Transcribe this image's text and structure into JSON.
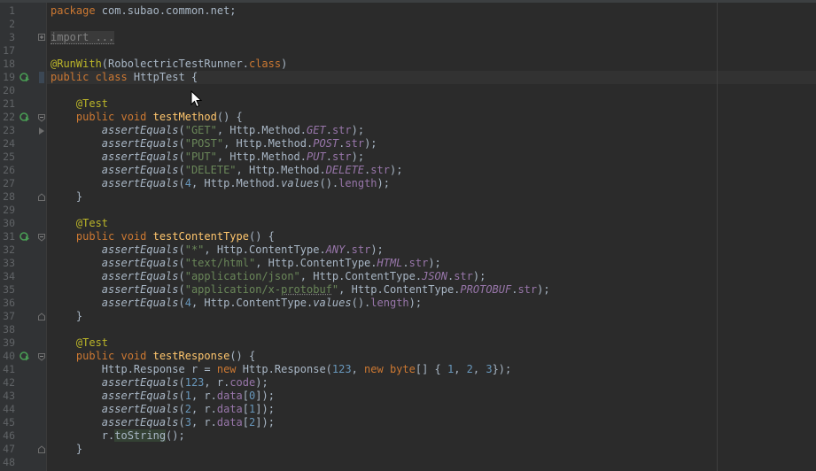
{
  "editor": {
    "file": "HttpTest",
    "current_line_index": 5,
    "lines": [
      {
        "n": "1",
        "tokens": [
          {
            "t": "package ",
            "c": "kw"
          },
          {
            "t": "com.subao.common.net;",
            "c": ""
          }
        ]
      },
      {
        "n": "2",
        "tokens": []
      },
      {
        "n": "3",
        "fold": "plus",
        "tokens": [
          {
            "t": "import ...",
            "c": "fold-box"
          }
        ]
      },
      {
        "n": "17",
        "tokens": []
      },
      {
        "n": "18",
        "tokens": [
          {
            "t": "@RunWith",
            "c": "ann"
          },
          {
            "t": "(RobolectricTestRunner.",
            "c": ""
          },
          {
            "t": "class",
            "c": "kw"
          },
          {
            "t": ")",
            "c": ""
          }
        ]
      },
      {
        "n": "19",
        "run": true,
        "tokens": [
          {
            "t": "public class ",
            "c": "kw"
          },
          {
            "t": "HttpTest {",
            "c": ""
          }
        ]
      },
      {
        "n": "20",
        "tokens": []
      },
      {
        "n": "21",
        "tokens": [
          {
            "t": "    ",
            "c": ""
          },
          {
            "t": "@Test",
            "c": "ann"
          }
        ]
      },
      {
        "n": "22",
        "run": true,
        "fold": "open",
        "tokens": [
          {
            "t": "    ",
            "c": ""
          },
          {
            "t": "public void ",
            "c": "kw"
          },
          {
            "t": "testMethod",
            "c": "fn"
          },
          {
            "t": "() {",
            "c": ""
          }
        ]
      },
      {
        "n": "23",
        "tokens": [
          {
            "t": "        ",
            "c": ""
          },
          {
            "t": "assertEquals",
            "c": "it"
          },
          {
            "t": "(",
            "c": ""
          },
          {
            "t": "\"GET\"",
            "c": "str"
          },
          {
            "t": ", Http.Method.",
            "c": ""
          },
          {
            "t": "GET",
            "c": "sfld"
          },
          {
            "t": ".",
            "c": ""
          },
          {
            "t": "str",
            "c": "fld"
          },
          {
            "t": ");",
            "c": ""
          }
        ]
      },
      {
        "n": "24",
        "tokens": [
          {
            "t": "        ",
            "c": ""
          },
          {
            "t": "assertEquals",
            "c": "it"
          },
          {
            "t": "(",
            "c": ""
          },
          {
            "t": "\"POST\"",
            "c": "str"
          },
          {
            "t": ", Http.Method.",
            "c": ""
          },
          {
            "t": "POST",
            "c": "sfld"
          },
          {
            "t": ".",
            "c": ""
          },
          {
            "t": "str",
            "c": "fld"
          },
          {
            "t": ");",
            "c": ""
          }
        ]
      },
      {
        "n": "25",
        "tokens": [
          {
            "t": "        ",
            "c": ""
          },
          {
            "t": "assertEquals",
            "c": "it"
          },
          {
            "t": "(",
            "c": ""
          },
          {
            "t": "\"PUT\"",
            "c": "str"
          },
          {
            "t": ", Http.Method.",
            "c": ""
          },
          {
            "t": "PUT",
            "c": "sfld"
          },
          {
            "t": ".",
            "c": ""
          },
          {
            "t": "str",
            "c": "fld"
          },
          {
            "t": ");",
            "c": ""
          }
        ]
      },
      {
        "n": "26",
        "tokens": [
          {
            "t": "        ",
            "c": ""
          },
          {
            "t": "assertEquals",
            "c": "it"
          },
          {
            "t": "(",
            "c": ""
          },
          {
            "t": "\"DELETE\"",
            "c": "str"
          },
          {
            "t": ", Http.Method.",
            "c": ""
          },
          {
            "t": "DELETE",
            "c": "sfld"
          },
          {
            "t": ".",
            "c": ""
          },
          {
            "t": "str",
            "c": "fld"
          },
          {
            "t": ");",
            "c": ""
          }
        ]
      },
      {
        "n": "27",
        "tokens": [
          {
            "t": "        ",
            "c": ""
          },
          {
            "t": "assertEquals",
            "c": "it"
          },
          {
            "t": "(",
            "c": ""
          },
          {
            "t": "4",
            "c": "num"
          },
          {
            "t": ", Http.Method.",
            "c": ""
          },
          {
            "t": "values",
            "c": "it"
          },
          {
            "t": "().",
            "c": ""
          },
          {
            "t": "length",
            "c": "fld"
          },
          {
            "t": ");",
            "c": ""
          }
        ]
      },
      {
        "n": "28",
        "fold": "close",
        "tokens": [
          {
            "t": "    }",
            "c": ""
          }
        ]
      },
      {
        "n": "29",
        "tokens": []
      },
      {
        "n": "30",
        "tokens": [
          {
            "t": "    ",
            "c": ""
          },
          {
            "t": "@Test",
            "c": "ann"
          }
        ]
      },
      {
        "n": "31",
        "run": true,
        "fold": "open",
        "tokens": [
          {
            "t": "    ",
            "c": ""
          },
          {
            "t": "public void ",
            "c": "kw"
          },
          {
            "t": "testContentType",
            "c": "fn"
          },
          {
            "t": "() {",
            "c": ""
          }
        ]
      },
      {
        "n": "32",
        "tokens": [
          {
            "t": "        ",
            "c": ""
          },
          {
            "t": "assertEquals",
            "c": "it"
          },
          {
            "t": "(",
            "c": ""
          },
          {
            "t": "\"*\"",
            "c": "str"
          },
          {
            "t": ", Http.ContentType.",
            "c": ""
          },
          {
            "t": "ANY",
            "c": "sfld"
          },
          {
            "t": ".",
            "c": ""
          },
          {
            "t": "str",
            "c": "fld"
          },
          {
            "t": ");",
            "c": ""
          }
        ]
      },
      {
        "n": "33",
        "tokens": [
          {
            "t": "        ",
            "c": ""
          },
          {
            "t": "assertEquals",
            "c": "it"
          },
          {
            "t": "(",
            "c": ""
          },
          {
            "t": "\"text/html\"",
            "c": "str"
          },
          {
            "t": ", Http.ContentType.",
            "c": ""
          },
          {
            "t": "HTML",
            "c": "sfld"
          },
          {
            "t": ".",
            "c": ""
          },
          {
            "t": "str",
            "c": "fld"
          },
          {
            "t": ");",
            "c": ""
          }
        ]
      },
      {
        "n": "34",
        "tokens": [
          {
            "t": "        ",
            "c": ""
          },
          {
            "t": "assertEquals",
            "c": "it"
          },
          {
            "t": "(",
            "c": ""
          },
          {
            "t": "\"application/json\"",
            "c": "str"
          },
          {
            "t": ", Http.ContentType.",
            "c": ""
          },
          {
            "t": "JSON",
            "c": "sfld"
          },
          {
            "t": ".",
            "c": ""
          },
          {
            "t": "str",
            "c": "fld"
          },
          {
            "t": ");",
            "c": ""
          }
        ]
      },
      {
        "n": "35",
        "tokens": [
          {
            "t": "        ",
            "c": ""
          },
          {
            "t": "assertEquals",
            "c": "it"
          },
          {
            "t": "(",
            "c": ""
          },
          {
            "t": "\"application/x-",
            "c": "str"
          },
          {
            "t": "protobuf",
            "c": "str warn"
          },
          {
            "t": "\"",
            "c": "str"
          },
          {
            "t": ", Http.ContentType.",
            "c": ""
          },
          {
            "t": "PROTOBUF",
            "c": "sfld"
          },
          {
            "t": ".",
            "c": ""
          },
          {
            "t": "str",
            "c": "fld"
          },
          {
            "t": ");",
            "c": ""
          }
        ]
      },
      {
        "n": "36",
        "tokens": [
          {
            "t": "        ",
            "c": ""
          },
          {
            "t": "assertEquals",
            "c": "it"
          },
          {
            "t": "(",
            "c": ""
          },
          {
            "t": "4",
            "c": "num"
          },
          {
            "t": ", Http.ContentType.",
            "c": ""
          },
          {
            "t": "values",
            "c": "it"
          },
          {
            "t": "().",
            "c": ""
          },
          {
            "t": "length",
            "c": "fld"
          },
          {
            "t": ");",
            "c": ""
          }
        ]
      },
      {
        "n": "37",
        "fold": "close",
        "tokens": [
          {
            "t": "    }",
            "c": ""
          }
        ]
      },
      {
        "n": "38",
        "tokens": []
      },
      {
        "n": "39",
        "tokens": [
          {
            "t": "    ",
            "c": ""
          },
          {
            "t": "@Test",
            "c": "ann"
          }
        ]
      },
      {
        "n": "40",
        "run": true,
        "fold": "open",
        "tokens": [
          {
            "t": "    ",
            "c": ""
          },
          {
            "t": "public void ",
            "c": "kw"
          },
          {
            "t": "testResponse",
            "c": "fn"
          },
          {
            "t": "() {",
            "c": ""
          }
        ]
      },
      {
        "n": "41",
        "tokens": [
          {
            "t": "        Http.Response r = ",
            "c": ""
          },
          {
            "t": "new ",
            "c": "kw"
          },
          {
            "t": "Http.Response(",
            "c": ""
          },
          {
            "t": "123",
            "c": "num"
          },
          {
            "t": ", ",
            "c": ""
          },
          {
            "t": "new byte",
            "c": "kw"
          },
          {
            "t": "[] { ",
            "c": ""
          },
          {
            "t": "1",
            "c": "num"
          },
          {
            "t": ", ",
            "c": ""
          },
          {
            "t": "2",
            "c": "num"
          },
          {
            "t": ", ",
            "c": ""
          },
          {
            "t": "3",
            "c": "num"
          },
          {
            "t": "});",
            "c": ""
          }
        ]
      },
      {
        "n": "42",
        "tokens": [
          {
            "t": "        ",
            "c": ""
          },
          {
            "t": "assertEquals",
            "c": "it"
          },
          {
            "t": "(",
            "c": ""
          },
          {
            "t": "123",
            "c": "num"
          },
          {
            "t": ", r.",
            "c": ""
          },
          {
            "t": "code",
            "c": "fld"
          },
          {
            "t": ");",
            "c": ""
          }
        ]
      },
      {
        "n": "43",
        "tokens": [
          {
            "t": "        ",
            "c": ""
          },
          {
            "t": "assertEquals",
            "c": "it"
          },
          {
            "t": "(",
            "c": ""
          },
          {
            "t": "1",
            "c": "num"
          },
          {
            "t": ", r.",
            "c": ""
          },
          {
            "t": "data",
            "c": "fld"
          },
          {
            "t": "[",
            "c": ""
          },
          {
            "t": "0",
            "c": "num"
          },
          {
            "t": "]);",
            "c": ""
          }
        ]
      },
      {
        "n": "44",
        "tokens": [
          {
            "t": "        ",
            "c": ""
          },
          {
            "t": "assertEquals",
            "c": "it"
          },
          {
            "t": "(",
            "c": ""
          },
          {
            "t": "2",
            "c": "num"
          },
          {
            "t": ", r.",
            "c": ""
          },
          {
            "t": "data",
            "c": "fld"
          },
          {
            "t": "[",
            "c": ""
          },
          {
            "t": "1",
            "c": "num"
          },
          {
            "t": "]);",
            "c": ""
          }
        ]
      },
      {
        "n": "45",
        "tokens": [
          {
            "t": "        ",
            "c": ""
          },
          {
            "t": "assertEquals",
            "c": "it"
          },
          {
            "t": "(",
            "c": ""
          },
          {
            "t": "3",
            "c": "num"
          },
          {
            "t": ", r.",
            "c": ""
          },
          {
            "t": "data",
            "c": "fld"
          },
          {
            "t": "[",
            "c": ""
          },
          {
            "t": "2",
            "c": "num"
          },
          {
            "t": "]);",
            "c": ""
          }
        ]
      },
      {
        "n": "46",
        "tokens": [
          {
            "t": "        r.",
            "c": ""
          },
          {
            "t": "toString",
            "c": "hl"
          },
          {
            "t": "();",
            "c": ""
          }
        ]
      },
      {
        "n": "47",
        "fold": "close",
        "tokens": [
          {
            "t": "    }",
            "c": ""
          }
        ]
      },
      {
        "n": "48",
        "tokens": []
      }
    ]
  },
  "icons": {
    "run": "run-test-icon",
    "fold_open": "fold-open-icon",
    "fold_close": "fold-close-icon",
    "fold_plus": "fold-expand-icon",
    "cursor": "mouse-cursor-icon"
  }
}
